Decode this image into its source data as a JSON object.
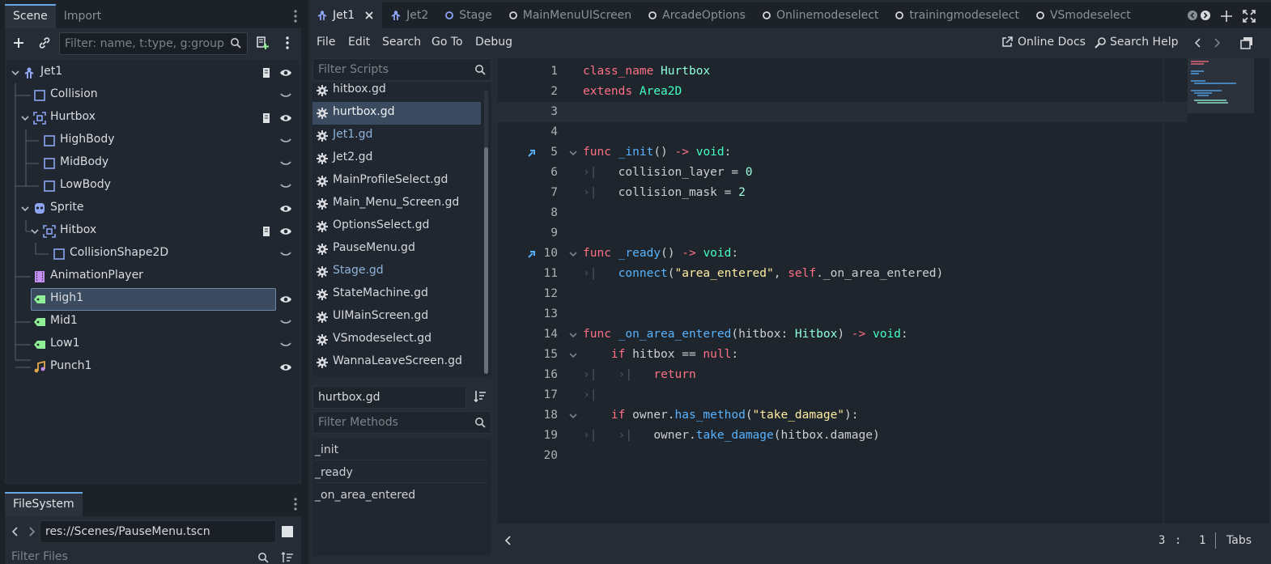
{
  "left_dock": {
    "tabs": [
      {
        "label": "Scene",
        "active": true
      },
      {
        "label": "Import",
        "active": false
      }
    ],
    "filter_placeholder": "Filter: name, t:type, g:group",
    "tree": [
      {
        "label": "Jet1",
        "icon": "character-body-icon",
        "indent": 0,
        "expander": true,
        "script": true,
        "visibility": "eye"
      },
      {
        "label": "Collision",
        "icon": "collision-shape-icon",
        "indent": 1,
        "expander": false,
        "script": false,
        "visibility": "closed"
      },
      {
        "label": "Hurtbox",
        "icon": "area2d-icon",
        "indent": 1,
        "expander": true,
        "script": true,
        "visibility": "eye"
      },
      {
        "label": "HighBody",
        "icon": "collision-shape-icon",
        "indent": 2,
        "expander": false,
        "script": false,
        "visibility": "closed"
      },
      {
        "label": "MidBody",
        "icon": "collision-shape-icon",
        "indent": 2,
        "expander": false,
        "script": false,
        "visibility": "closed"
      },
      {
        "label": "LowBody",
        "icon": "collision-shape-icon",
        "indent": 2,
        "expander": false,
        "script": false,
        "visibility": "closed"
      },
      {
        "label": "Sprite",
        "icon": "sprite-icon",
        "indent": 1,
        "expander": true,
        "script": false,
        "visibility": "eye"
      },
      {
        "label": "Hitbox",
        "icon": "area2d-icon",
        "indent": 2,
        "expander": true,
        "script": true,
        "visibility": "eye"
      },
      {
        "label": "CollisionShape2D",
        "icon": "collision-shape-icon",
        "indent": 3,
        "expander": false,
        "script": false,
        "visibility": "closed"
      },
      {
        "label": "AnimationPlayer",
        "icon": "animation-player-icon",
        "indent": 1,
        "expander": false,
        "script": false,
        "visibility": "none"
      },
      {
        "label": "High1",
        "icon": "label-tag-icon",
        "indent": 1,
        "expander": false,
        "script": false,
        "visibility": "eye",
        "selected": true
      },
      {
        "label": "Mid1",
        "icon": "label-tag-icon",
        "indent": 1,
        "expander": false,
        "script": false,
        "visibility": "closed"
      },
      {
        "label": "Low1",
        "icon": "label-tag-icon",
        "indent": 1,
        "expander": false,
        "script": false,
        "visibility": "closed"
      },
      {
        "label": "Punch1",
        "icon": "audio-player-icon",
        "indent": 1,
        "expander": false,
        "script": false,
        "visibility": "eye"
      }
    ],
    "filesystem": {
      "tab_label": "FileSystem",
      "path": "res://Scenes/PauseMenu.tscn",
      "filter_placeholder": "Filter Files"
    }
  },
  "editor": {
    "doc_tabs": [
      {
        "label": "Jet1",
        "icon": "character-body-icon",
        "active": true
      },
      {
        "label": "Jet2",
        "icon": "character-body-icon",
        "active": false
      },
      {
        "label": "Stage",
        "icon": "node-circle-icon",
        "active": false
      },
      {
        "label": "MainMenuUIScreen",
        "icon": "node-circle-icon",
        "active": false
      },
      {
        "label": "ArcadeOptions",
        "icon": "node-circle-icon",
        "active": false
      },
      {
        "label": "Onlinemodeselect",
        "icon": "node-circle-icon",
        "active": false
      },
      {
        "label": "trainingmodeselect",
        "icon": "node-circle-icon",
        "active": false
      },
      {
        "label": "VSmodeselect",
        "icon": "node-circle-icon",
        "active": false
      }
    ],
    "menu": [
      "File",
      "Edit",
      "Search",
      "Go To",
      "Debug"
    ],
    "online_docs": "Online Docs",
    "search_help": "Search Help",
    "filter_scripts_placeholder": "Filter Scripts",
    "scripts": [
      {
        "name": "hitbox.gd",
        "state": "normal"
      },
      {
        "name": "hurtbox.gd",
        "state": "selected"
      },
      {
        "name": "Jet1.gd",
        "state": "blue"
      },
      {
        "name": "Jet2.gd",
        "state": "normal"
      },
      {
        "name": "MainProfileSelect.gd",
        "state": "normal"
      },
      {
        "name": "Main_Menu_Screen.gd",
        "state": "normal"
      },
      {
        "name": "OptionsSelect.gd",
        "state": "normal"
      },
      {
        "name": "PauseMenu.gd",
        "state": "normal"
      },
      {
        "name": "Stage.gd",
        "state": "blue"
      },
      {
        "name": "StateMachine.gd",
        "state": "normal"
      },
      {
        "name": "UIMainScreen.gd",
        "state": "normal"
      },
      {
        "name": "VSmodeselect.gd",
        "state": "normal"
      },
      {
        "name": "WannaLeaveScreen.gd",
        "state": "normal"
      }
    ],
    "current_script": "hurtbox.gd",
    "filter_methods_placeholder": "Filter Methods",
    "methods": [
      "_init",
      "_ready",
      "_on_area_entered"
    ],
    "code_lines": [
      {
        "n": "1",
        "text": "class_name Hurtbox"
      },
      {
        "n": "2",
        "text": "extends Area2D"
      },
      {
        "n": "3",
        "text": ""
      },
      {
        "n": "4",
        "text": ""
      },
      {
        "n": "5",
        "text": "func _init() -> void:"
      },
      {
        "n": "6",
        "text": "    collision_layer = 0"
      },
      {
        "n": "7",
        "text": "    collision_mask = 2"
      },
      {
        "n": "8",
        "text": ""
      },
      {
        "n": "9",
        "text": ""
      },
      {
        "n": "10",
        "text": "func _ready() -> void:"
      },
      {
        "n": "11",
        "text": "    connect(\"area_entered\", self._on_area_entered)"
      },
      {
        "n": "12",
        "text": ""
      },
      {
        "n": "13",
        "text": ""
      },
      {
        "n": "14",
        "text": "func _on_area_entered(hitbox: Hitbox) -> void:"
      },
      {
        "n": "15",
        "text": "    if hitbox == null:"
      },
      {
        "n": "16",
        "text": "        return"
      },
      {
        "n": "17",
        "text": ""
      },
      {
        "n": "18",
        "text": "    if owner.has_method(\"take_damage\"):"
      },
      {
        "n": "19",
        "text": "        owner.take_damage(hitbox.damage)"
      },
      {
        "n": "20",
        "text": ""
      }
    ],
    "status": {
      "line": "3",
      "sep": ":",
      "col": "1",
      "indent": "Tabs"
    }
  },
  "colors": {
    "accent": "#67a7e6",
    "keyword": "#ff7085",
    "function": "#57b3ff",
    "type": "#42ffc2",
    "string": "#ffeda1"
  }
}
